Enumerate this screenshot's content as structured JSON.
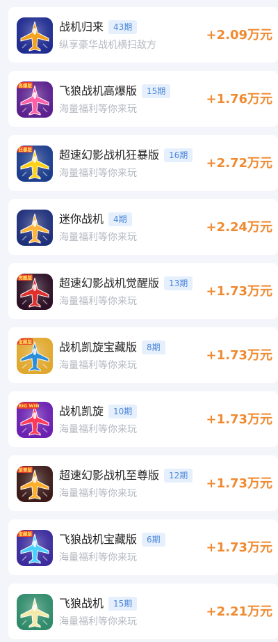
{
  "games": [
    {
      "title": "战机归来",
      "issue": "43期",
      "subtitle": "纵享豪华战机横扫敌方",
      "reward": "+2.09万元",
      "icon": "jet-game-icon",
      "bg": "#1f2b8f",
      "accent": "#f4a11d",
      "banner": ""
    },
    {
      "title": "飞狼战机高爆版",
      "issue": "15期",
      "subtitle": "海量福利等你来玩",
      "reward": "+1.76万元",
      "icon": "jet-game-icon",
      "bg": "#5a1f8d",
      "accent": "#ff5fa8",
      "banner": "高爆版"
    },
    {
      "title": "超速幻影战机狂暴版",
      "issue": "16期",
      "subtitle": "海量福利等你来玩",
      "reward": "+2.72万元",
      "icon": "jet-game-icon",
      "bg": "#1c3c8c",
      "accent": "#ffd21a",
      "banner": "狂暴版"
    },
    {
      "title": "迷你战机",
      "issue": "4期",
      "subtitle": "海量福利等你来玩",
      "reward": "+2.24万元",
      "icon": "jet-game-icon",
      "bg": "#1e2f7a",
      "accent": "#ffb43a",
      "banner": ""
    },
    {
      "title": "超速幻影战机觉醒版",
      "issue": "13期",
      "subtitle": "海量福利等你来玩",
      "reward": "+1.73万元",
      "icon": "jet-game-icon",
      "bg": "#2b0f24",
      "accent": "#e0302e",
      "banner": "觉醒版"
    },
    {
      "title": "战机凯旋宝藏版",
      "issue": "8期",
      "subtitle": "海量福利等你来玩",
      "reward": "+1.73万元",
      "icon": "jet-game-icon",
      "bg": "#e0a72c",
      "accent": "#2d8ed8",
      "banner": "宝藏版"
    },
    {
      "title": "战机凯旋",
      "issue": "10期",
      "subtitle": "海量福利等你来玩",
      "reward": "+1.73万元",
      "icon": "jet-game-icon",
      "bg": "#6a1fb0",
      "accent": "#ff3b5c",
      "banner": "BIG WIN"
    },
    {
      "title": "超速幻影战机至尊版",
      "issue": "12期",
      "subtitle": "海量福利等你来玩",
      "reward": "+1.73万元",
      "icon": "jet-game-icon",
      "bg": "#3a1a18",
      "accent": "#ffae2a",
      "banner": "至尊版"
    },
    {
      "title": "飞狼战机宝藏版",
      "issue": "6期",
      "subtitle": "海量福利等你来玩",
      "reward": "+1.73万元",
      "icon": "jet-game-icon",
      "bg": "#3a2a9c",
      "accent": "#4ad1ff",
      "banner": "宝藏版"
    },
    {
      "title": "飞狼战机",
      "issue": "15期",
      "subtitle": "海量福利等你来玩",
      "reward": "+2.21万元",
      "icon": "jet-game-icon",
      "bg": "#2f8a6a",
      "accent": "#f3e9a8",
      "banner": ""
    }
  ]
}
